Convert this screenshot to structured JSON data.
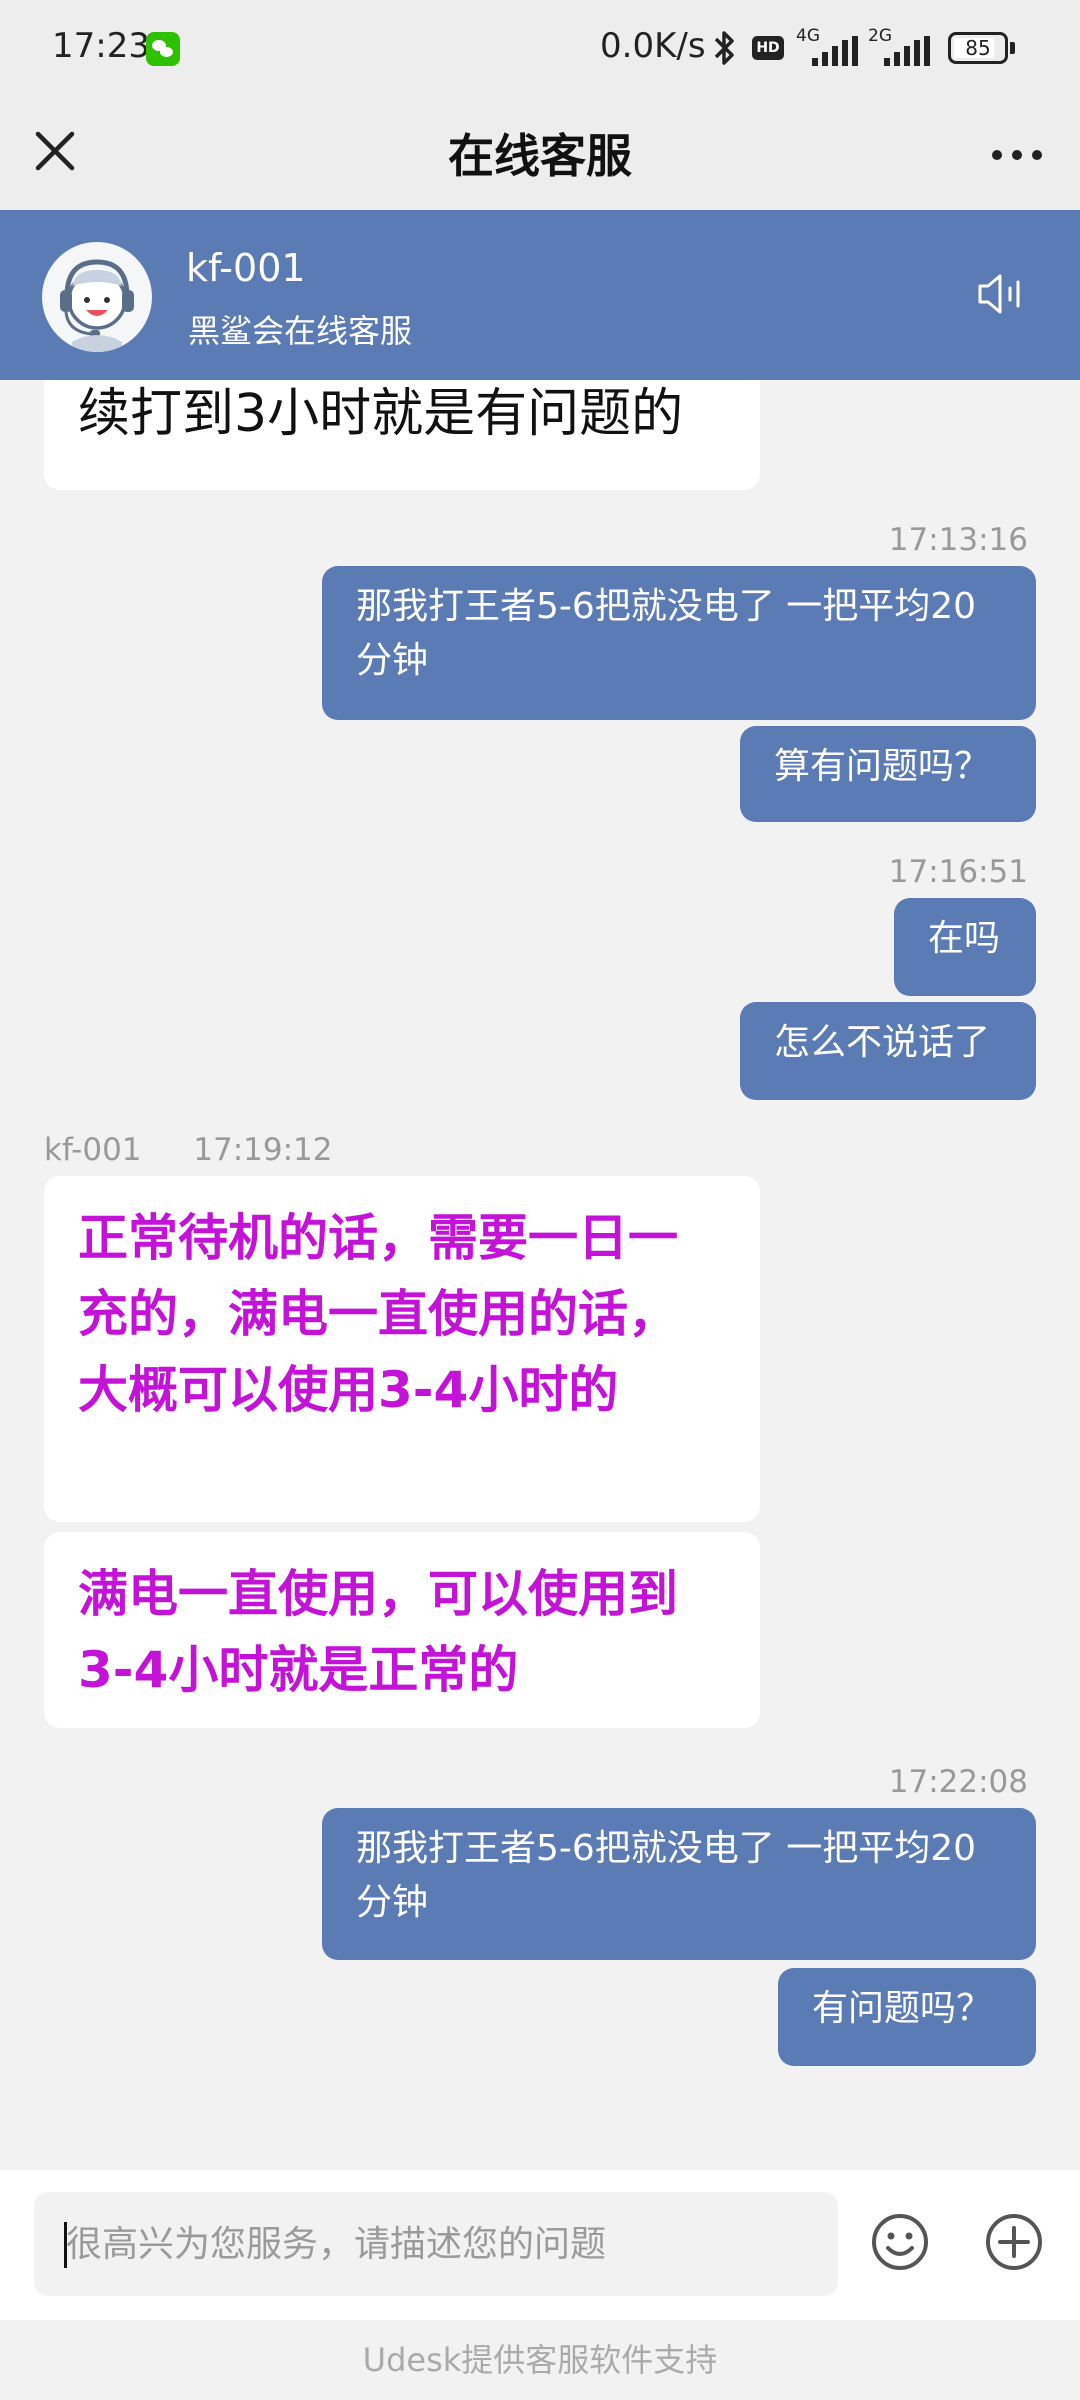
{
  "status_bar": {
    "time": "17:23",
    "net_speed": "0.0K/s",
    "hd": "HD",
    "signal_1": "4G",
    "signal_2": "2G",
    "battery": "85",
    "battery_level": 0.85,
    "icons": [
      "wechat-icon",
      "bluetooth-icon",
      "hd-icon",
      "signal-4g-icon",
      "signal-2g-icon",
      "battery-icon"
    ]
  },
  "nav": {
    "title": "在线客服",
    "close_icon": "close-icon",
    "more_icon": "more-icon"
  },
  "agent": {
    "name": "kf-001",
    "subtitle": "黑鲨会在线客服",
    "avatar_icon": "agent-avatar",
    "speaker_icon": "speaker-icon"
  },
  "messages": {
    "m0": "续打到3小时就是有问题的",
    "t1": "17:13:16",
    "m1": "那我打王者5-6把就没电了 一把平均20分钟",
    "m2": "算有问题吗？",
    "t2": "17:16:51",
    "m3": "在吗",
    "m4": "怎么不说话了",
    "agent_stamp_name": "kf-001",
    "agent_stamp_time": "17:19:12",
    "m5": "正常待机的话，需要一日一充的，满电一直使用的话，大概可以使用3-4小时的",
    "m6": "满电一直使用，可以使用到3-4小时就是正常的",
    "t3": "17:22:08",
    "m7": "那我打王者5-6把就没电了 一把平均20分钟",
    "m8": "有问题吗？"
  },
  "input": {
    "placeholder": "很高兴为您服务，请描述您的问题",
    "emoji_icon": "emoji-icon",
    "plus_icon": "plus-icon"
  },
  "footer": {
    "text": "Udesk提供客服软件支持"
  },
  "colors": {
    "accent": "#5b7bb5",
    "highlight_text": "#c313d6",
    "background": "#f2f2f2"
  }
}
